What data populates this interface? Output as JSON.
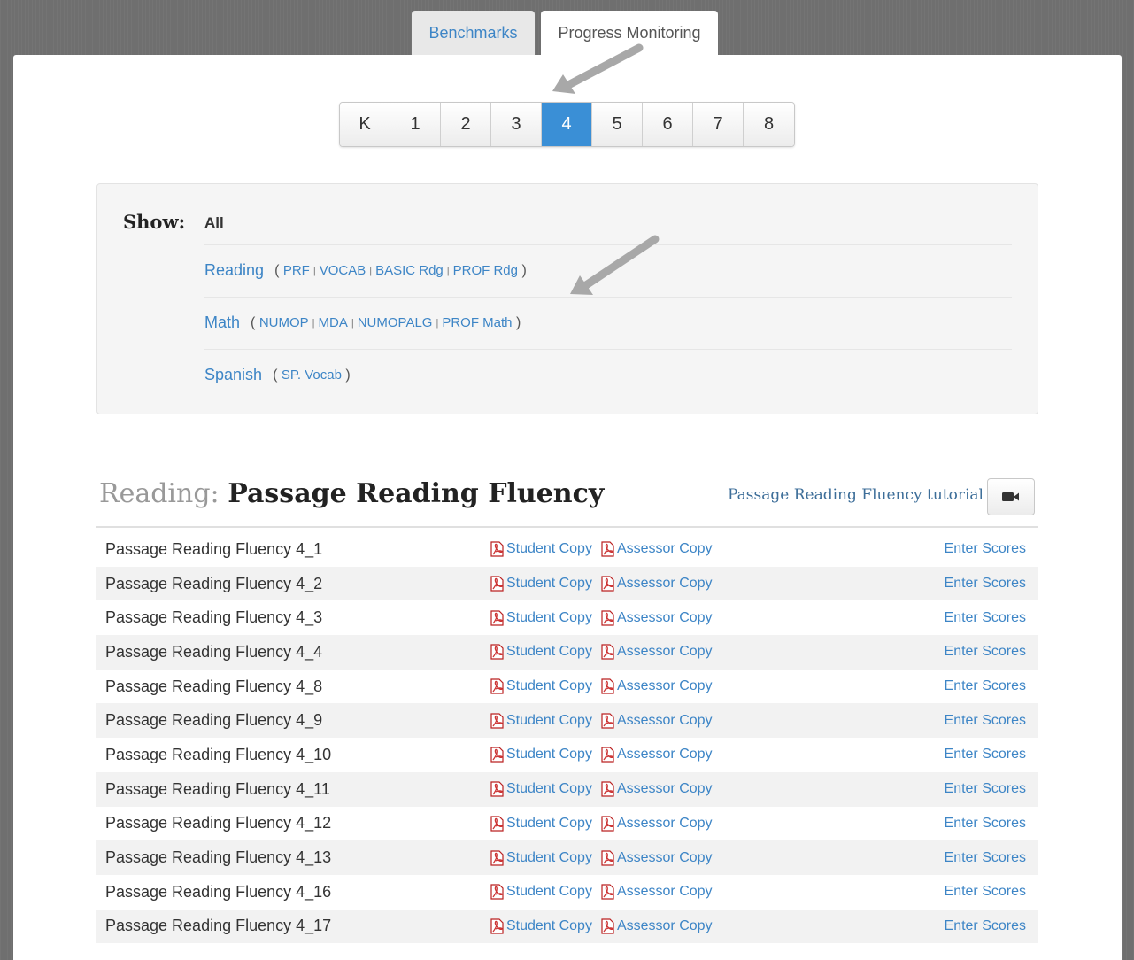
{
  "tabs": [
    {
      "label": "Benchmarks"
    },
    {
      "label": "Progress Monitoring"
    }
  ],
  "grades": {
    "items": [
      "K",
      "1",
      "2",
      "3",
      "4",
      "5",
      "6",
      "7",
      "8"
    ],
    "selected": "4"
  },
  "filters": {
    "show_label": "Show:",
    "all_label": "All",
    "subjects": [
      {
        "label": "Reading",
        "subtests": [
          "PRF",
          "VOCAB",
          "BASIC Rdg",
          "PROF Rdg"
        ]
      },
      {
        "label": "Math",
        "subtests": [
          "NUMOP",
          "MDA",
          "NUMOPALG",
          "PROF Math"
        ]
      },
      {
        "label": "Spanish",
        "subtests": [
          "SP. Vocab"
        ]
      }
    ]
  },
  "section": {
    "category": "Reading:",
    "title": "Passage Reading Fluency",
    "tutorial_label": "Passage Reading Fluency tutorial",
    "video_icon": "video-camera-icon"
  },
  "assessments": {
    "student_copy_label": "Student Copy",
    "assessor_copy_label": "Assessor Copy",
    "enter_scores_label": "Enter Scores",
    "pdf_icon": "pdf-icon",
    "rows": [
      "Passage Reading Fluency 4_1",
      "Passage Reading Fluency 4_2",
      "Passage Reading Fluency 4_3",
      "Passage Reading Fluency 4_4",
      "Passage Reading Fluency 4_8",
      "Passage Reading Fluency 4_9",
      "Passage Reading Fluency 4_10",
      "Passage Reading Fluency 4_11",
      "Passage Reading Fluency 4_12",
      "Passage Reading Fluency 4_13",
      "Passage Reading Fluency 4_16",
      "Passage Reading Fluency 4_17"
    ]
  },
  "colors": {
    "link": "#3d85c6",
    "active_grade": "#3a8fd6",
    "annotation_arrow": "#a8a8a8"
  }
}
